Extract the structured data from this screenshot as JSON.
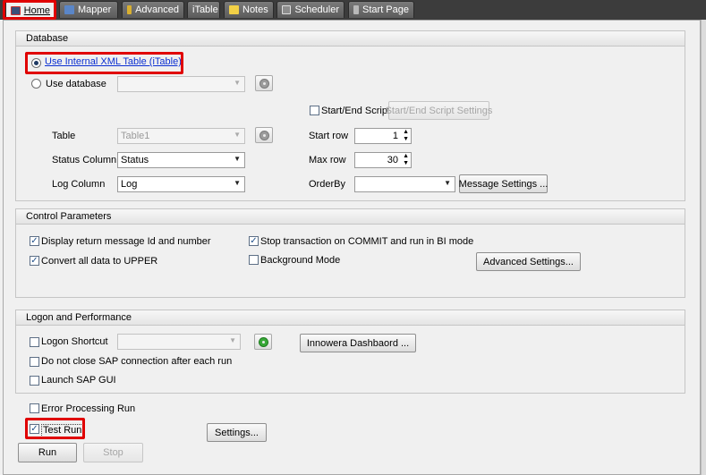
{
  "tabs": [
    {
      "label": "Home",
      "icon": "home-icon"
    },
    {
      "label": "Mapper",
      "icon": "mapper-icon"
    },
    {
      "label": "Advanced",
      "icon": "advanced-icon"
    },
    {
      "label": "iTable",
      "icon": ""
    },
    {
      "label": "Notes",
      "icon": "notes-icon"
    },
    {
      "label": "Scheduler",
      "icon": "scheduler-icon"
    },
    {
      "label": "Start Page",
      "icon": "start-page-icon"
    }
  ],
  "database": {
    "header": "Database",
    "use_internal_label": "Use Internal XML Table (iTable)",
    "use_database_label": "Use  database",
    "database_value": "",
    "start_end_script_label": "Start/End Script",
    "start_end_settings_label": "Start/End Script Settings",
    "table_label": "Table",
    "table_value": "Table1",
    "status_column_label": "Status Column",
    "status_column_value": "Status",
    "log_column_label": "Log Column",
    "log_column_value": "Log",
    "start_row_label": "Start row",
    "start_row_value": "1",
    "max_row_label": "Max row",
    "max_row_value": "30",
    "orderby_label": "OrderBy",
    "orderby_value": "",
    "message_settings_label": "Message Settings ..."
  },
  "control": {
    "header": "Control Parameters",
    "display_return_label": "Display return message Id and number",
    "convert_upper_label": "Convert all data to UPPER",
    "stop_transaction_label": "Stop transaction on COMMIT and run in BI mode",
    "background_mode_label": "Background Mode",
    "advanced_settings_label": "Advanced Settings..."
  },
  "logon": {
    "header": "Logon and Performance",
    "logon_shortcut_label": "Logon Shortcut",
    "logon_shortcut_value": "",
    "innowera_dashboard_label": "Innowera Dashbaord ...",
    "do_not_close_label": "Do not close SAP connection after each run",
    "launch_sap_label": "Launch SAP GUI"
  },
  "run": {
    "error_processing_label": "Error Processing Run",
    "test_run_label": "Test Run",
    "settings_label": "Settings...",
    "run_label": "Run",
    "stop_label": "Stop"
  },
  "colors": {
    "highlight": "#e00000",
    "link": "#0b2fd2",
    "tabstrip": "#3c3c3c"
  }
}
